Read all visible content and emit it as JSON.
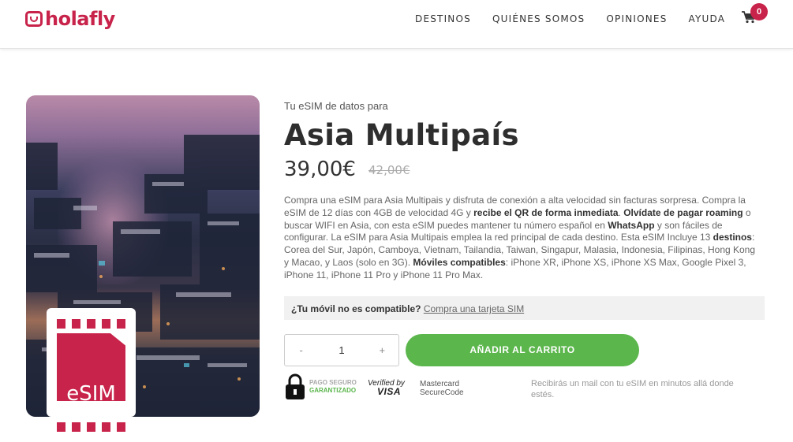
{
  "header": {
    "logo_text": "holafly",
    "nav": [
      "DESTINOS",
      "QUIÉNES SOMOS",
      "OPINIONES",
      "AYUDA"
    ],
    "cart_count": "0"
  },
  "product": {
    "subtitle": "Tu eSIM de datos para",
    "title": "Asia Multipaís",
    "price": "39,00€",
    "old_price": "42,00€",
    "image_badge": "eSIM",
    "description": {
      "p1": "Compra una eSIM para Asia Multipais y disfruta de conexión a alta velocidad sin facturas sorpresa. Compra la eSIM de 12 días con 4GB de velocidad 4G y ",
      "b1": "recibe el QR de forma inmediata",
      "p2": ". ",
      "b2": "Olvídate de pagar roaming",
      "p3": " o buscar WIFI en Asia, con esta eSIM puedes mantener tu número español en ",
      "b3": "WhatsApp",
      "p4": " y son fáciles de configurar. La eSIM para Asia Multipais emplea la red principal de cada destino. Esta eSIM Incluye 13 ",
      "b4": "destinos",
      "p5": ": Corea del Sur, Japón, Camboya, Vietnam, Tailandia, Taiwan, Singapur, Malasia, Indonesia, Filipinas, Hong Kong y Macao, y Laos (solo en 3G). ",
      "b5": "Móviles compatibles",
      "p6": ": iPhone XR, iPhone XS, iPhone XS Max, Google Pixel 3, iPhone 11, iPhone 11 Pro y iPhone 11 Pro Max."
    },
    "compat_question": "¿Tu móvil no es compatible?",
    "compat_link": "Compra una tarjeta SIM",
    "qty_minus": "-",
    "qty_value": "1",
    "qty_plus": "+",
    "add_to_cart": "AÑADIR AL CARRITO"
  },
  "trust": {
    "secure_line1": "PAGO SEGURO",
    "secure_line2": "GARANTIZADO",
    "visa_line1": "Verified by",
    "visa_line2": "VISA",
    "mc_line1": "Mastercard",
    "mc_line2": "SecureCode",
    "mail_note": "Recibirás un mail con tu eSIM en minutos allá donde estés."
  },
  "colors": {
    "brand": "#c8234a",
    "cta": "#5bb64c"
  }
}
